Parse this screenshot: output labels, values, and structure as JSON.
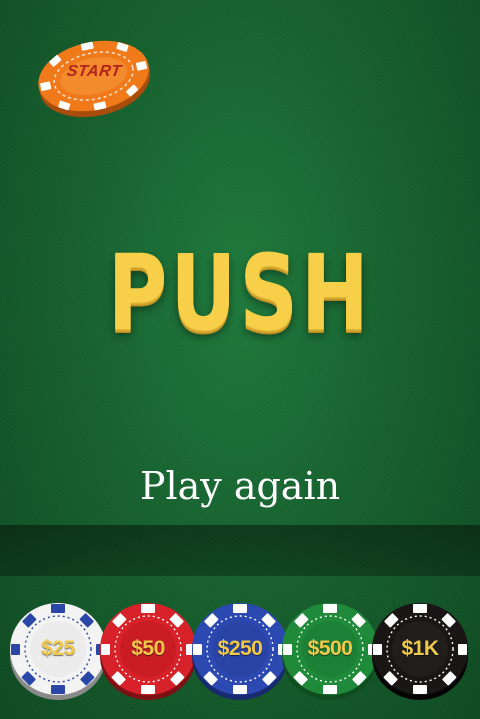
{
  "start_chip": {
    "label": "START",
    "color": "#f07a1a",
    "label_color": "#b4241a"
  },
  "result": {
    "text": "PUSH",
    "color": "#f7cf48"
  },
  "play_again": {
    "label": "Play again"
  },
  "table": {
    "felt_color": "#17622f"
  },
  "bet_chips": [
    {
      "label": "$25",
      "color": "#f3f3f3",
      "stripe": "#2a47a8",
      "icon": "chip-25-icon"
    },
    {
      "label": "$50",
      "color": "#d62228",
      "stripe": "#ffffff",
      "icon": "chip-50-icon"
    },
    {
      "label": "$250",
      "color": "#2c49b2",
      "stripe": "#ffffff",
      "icon": "chip-250-icon"
    },
    {
      "label": "$500",
      "color": "#1f8a3a",
      "stripe": "#ffffff",
      "icon": "chip-500-icon"
    },
    {
      "label": "$1K",
      "color": "#1a1616",
      "stripe": "#ffffff",
      "icon": "chip-1k-icon"
    }
  ]
}
